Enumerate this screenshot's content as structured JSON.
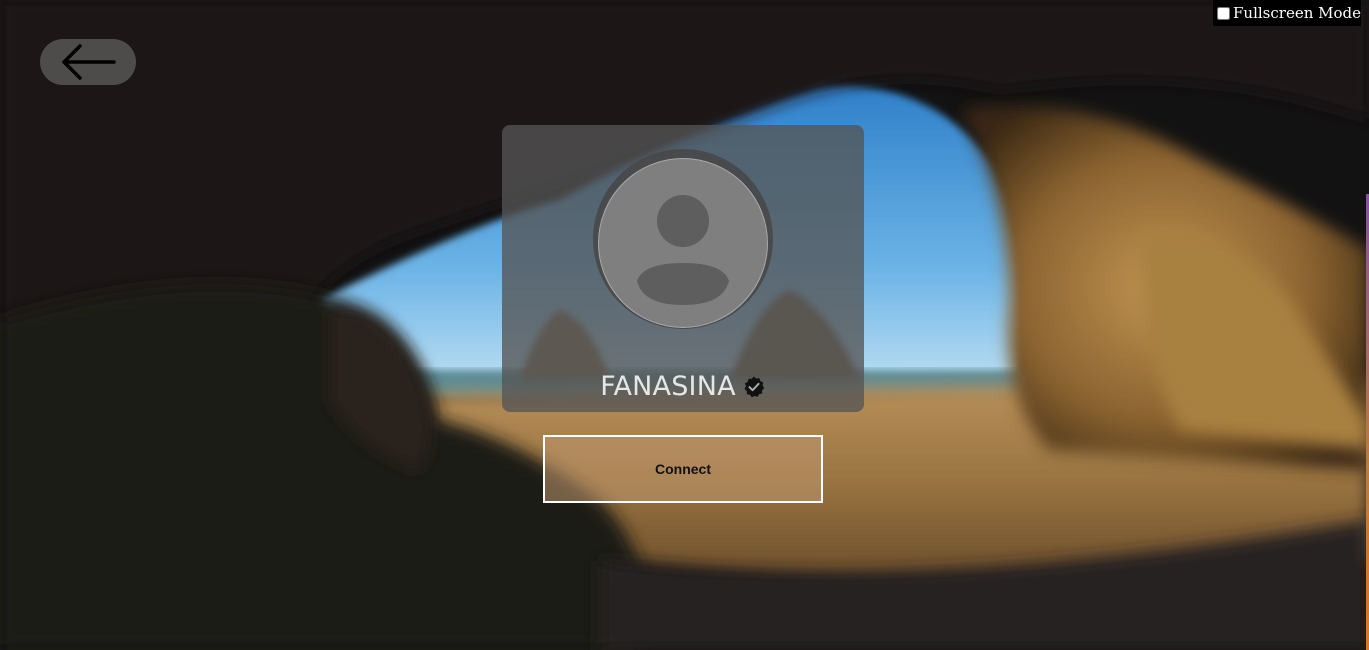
{
  "header": {
    "fullscreen_label": "Fullscreen Mode",
    "fullscreen_checked": false
  },
  "nav": {
    "back_icon": "arrow-left-icon"
  },
  "login": {
    "avatar_icon": "user-avatar-icon",
    "username": "FANASINA",
    "verified_icon": "verified-badge-icon",
    "connect_label": "Connect"
  },
  "colors": {
    "card_bg": "#555555",
    "button_border": "#ffffff",
    "avatar_bg": "#7f7f7f"
  }
}
